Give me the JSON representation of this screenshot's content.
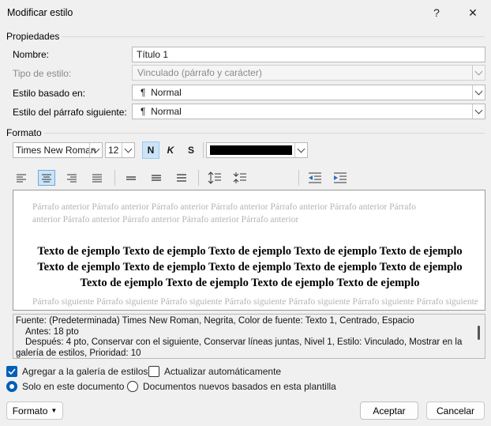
{
  "window": {
    "title": "Modificar estilo",
    "help_glyph": "?",
    "close_glyph": "✕"
  },
  "properties": {
    "section_label": "Propiedades",
    "name_label": "Nombre:",
    "name_value": "Título 1",
    "style_type_label": "Tipo de estilo:",
    "style_type_value": "Vinculado (párrafo y carácter)",
    "based_on_label": "Estilo basado en:",
    "based_on_value": "Normal",
    "next_style_label": "Estilo del párrafo siguiente:",
    "next_style_value": "Normal",
    "paragraph_mark": "¶"
  },
  "format": {
    "section_label": "Formato",
    "font": "Times New Roman",
    "size": "12",
    "bold": "N",
    "italic": "K",
    "underline": "S",
    "font_color": "#000000"
  },
  "preview": {
    "previous_paragraph": "Párrafo anterior Párrafo anterior Párrafo anterior Párrafo anterior Párrafo anterior Párrafo anterior Párrafo anterior Párrafo anterior Párrafo anterior Párrafo anterior Párrafo anterior",
    "sample_text": "Texto de ejemplo Texto de ejemplo Texto de ejemplo Texto de ejemplo Texto de ejemplo Texto de ejemplo Texto de ejemplo Texto de ejemplo Texto de ejemplo Texto de ejemplo Texto de ejemplo Texto de ejemplo Texto de ejemplo Texto de ejemplo",
    "next_paragraph": "Párrafo siguiente Párrafo siguiente Párrafo siguiente Párrafo siguiente Párrafo siguiente Párrafo siguiente Párrafo siguiente"
  },
  "description": {
    "line1": "Fuente: (Predeterminada) Times New Roman, Negrita, Color de fuente: Texto 1, Centrado, Espacio",
    "line2": "Antes:  18 pto",
    "line3": "Después:  4 pto, Conservar con el siguiente, Conservar líneas juntas, Nivel 1, Estilo: Vinculado, Mostrar en la",
    "line4": "galería de estilos, Prioridad: 10"
  },
  "options": {
    "add_gallery_label": "Agregar a la galería de estilos",
    "add_gallery_checked": true,
    "auto_update_label": "Actualizar automáticamente",
    "auto_update_checked": false,
    "only_document_label": "Solo en este documento",
    "new_documents_label": "Documentos nuevos basados en esta plantilla",
    "selected_scope": "only_document"
  },
  "buttons": {
    "format": "Formato",
    "ok": "Aceptar",
    "cancel": "Cancelar"
  },
  "colors": {
    "accent": "#005fb8",
    "selected_bg": "#cce4f7"
  }
}
